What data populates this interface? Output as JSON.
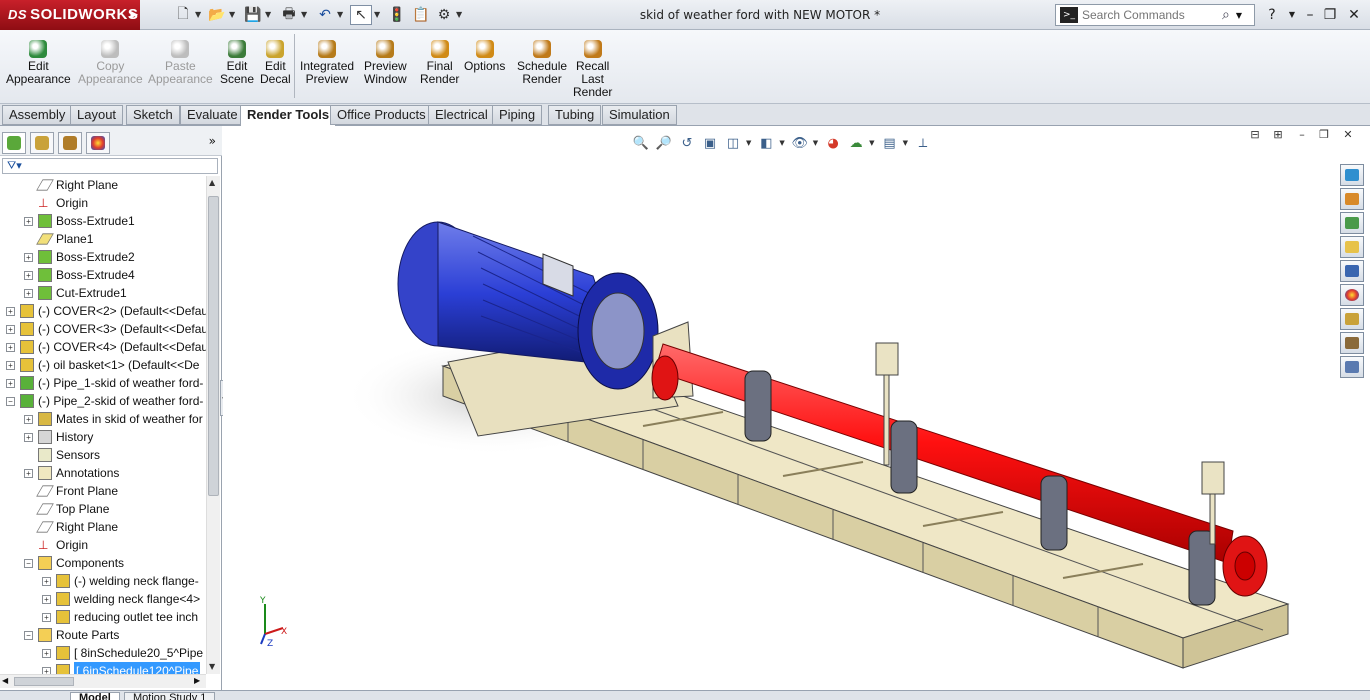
{
  "app": {
    "brand": "SOLIDWORKS",
    "brand_prefix": "DS",
    "doc_title": "skid of weather ford with NEW MOTOR *"
  },
  "search": {
    "placeholder": "Search Commands"
  },
  "command_manager": [
    {
      "label": "Edit Appearance",
      "lines": [
        "Edit",
        "Appearance"
      ],
      "enabled": true,
      "color": "#2e8b3d"
    },
    {
      "label": "Copy Appearance",
      "lines": [
        "Copy",
        "Appearance"
      ],
      "enabled": false,
      "color": "#bdbdbd"
    },
    {
      "label": "Paste Appearance",
      "lines": [
        "Paste",
        "Appearance"
      ],
      "enabled": false,
      "color": "#bdbdbd"
    },
    {
      "label": "Edit Scene",
      "lines": [
        "Edit",
        "Scene"
      ],
      "enabled": true,
      "color": "#3c7c3a"
    },
    {
      "label": "Edit Decal",
      "lines": [
        "Edit",
        "Decal"
      ],
      "enabled": true,
      "color": "#caa42e"
    },
    {
      "label": "Integrated Preview",
      "lines": [
        "Integrated",
        "Preview"
      ],
      "enabled": true,
      "color": "#b67b1a"
    },
    {
      "label": "Preview Window",
      "lines": [
        "Preview",
        "Window"
      ],
      "enabled": true,
      "color": "#b67b1a"
    },
    {
      "label": "Final Render",
      "lines": [
        "Final",
        "Render"
      ],
      "enabled": true,
      "color": "#d08a16"
    },
    {
      "label": "Options",
      "lines": [
        "Options"
      ],
      "enabled": true,
      "color": "#d08a16"
    },
    {
      "label": "Schedule Render",
      "lines": [
        "Schedule",
        "Render"
      ],
      "enabled": true,
      "color": "#c07a1a"
    },
    {
      "label": "Recall Last Render",
      "lines": [
        "Recall",
        "Last",
        "Render"
      ],
      "enabled": true,
      "color": "#c07a1a"
    }
  ],
  "tabs": [
    {
      "label": "Assembly",
      "active": false
    },
    {
      "label": "Layout",
      "active": false
    },
    {
      "label": "Sketch",
      "active": false
    },
    {
      "label": "Evaluate",
      "active": false
    },
    {
      "label": "Render Tools",
      "active": true
    },
    {
      "label": "Office Products",
      "active": false
    },
    {
      "label": "Electrical",
      "active": false
    },
    {
      "label": "Piping",
      "active": false
    },
    {
      "label": "Tubing",
      "active": false
    },
    {
      "label": "Simulation",
      "active": false
    }
  ],
  "tree": [
    {
      "label": "Right Plane",
      "level": 2,
      "icon": "plane",
      "expand": false
    },
    {
      "label": "Origin",
      "level": 2,
      "icon": "origin",
      "expand": false
    },
    {
      "label": "Boss-Extrude1",
      "level": 2,
      "icon": "feature",
      "expand": true
    },
    {
      "label": "Plane1",
      "level": 2,
      "icon": "plane-y",
      "expand": false
    },
    {
      "label": "Boss-Extrude2",
      "level": 2,
      "icon": "feature",
      "expand": true
    },
    {
      "label": "Boss-Extrude4",
      "level": 2,
      "icon": "feature",
      "expand": true
    },
    {
      "label": "Cut-Extrude1",
      "level": 2,
      "icon": "feature",
      "expand": true
    },
    {
      "label": "(-) COVER<2> (Default<<Defau",
      "level": 1,
      "icon": "part",
      "expand": true
    },
    {
      "label": "(-) COVER<3> (Default<<Defau",
      "level": 1,
      "icon": "part",
      "expand": true
    },
    {
      "label": "(-) COVER<4> (Default<<Defau",
      "level": 1,
      "icon": "part",
      "expand": true
    },
    {
      "label": "(-) oil basket<1> (Default<<De",
      "level": 1,
      "icon": "part",
      "expand": true
    },
    {
      "label": "(-) Pipe_1-skid of weather ford-",
      "level": 1,
      "icon": "assembly",
      "expand": true
    },
    {
      "label": "(-) Pipe_2-skid of weather ford-",
      "level": 1,
      "icon": "assembly",
      "expand": true,
      "open": true
    },
    {
      "label": "Mates in skid of weather for",
      "level": 2,
      "icon": "mates",
      "expand": true
    },
    {
      "label": "History",
      "level": 2,
      "icon": "history",
      "expand": true
    },
    {
      "label": "Sensors",
      "level": 2,
      "icon": "sensors",
      "expand": false
    },
    {
      "label": "Annotations",
      "level": 2,
      "icon": "annotations",
      "expand": true
    },
    {
      "label": "Front Plane",
      "level": 2,
      "icon": "plane",
      "expand": false
    },
    {
      "label": "Top Plane",
      "level": 2,
      "icon": "plane",
      "expand": false
    },
    {
      "label": "Right Plane",
      "level": 2,
      "icon": "plane",
      "expand": false
    },
    {
      "label": "Origin",
      "level": 2,
      "icon": "origin",
      "expand": false
    },
    {
      "label": "Components",
      "level": 2,
      "icon": "folder",
      "expand": true,
      "open": true
    },
    {
      "label": "(-) welding neck flange-",
      "level": 3,
      "icon": "part",
      "expand": true
    },
    {
      "label": "welding neck flange<4>",
      "level": 3,
      "icon": "part",
      "expand": true
    },
    {
      "label": "reducing outlet tee inch",
      "level": 3,
      "icon": "part",
      "expand": true
    },
    {
      "label": "Route Parts",
      "level": 2,
      "icon": "folder",
      "expand": true,
      "open": true
    },
    {
      "label": "[ 8inSchedule20_5^Pipe",
      "level": 3,
      "icon": "part",
      "expand": true
    },
    {
      "label": "[ 6inSchedule120^Pipe",
      "level": 3,
      "icon": "part",
      "expand": true,
      "selected": true
    }
  ],
  "bottom_tabs": [
    {
      "label": "Model",
      "active": true
    },
    {
      "label": "Motion Study 1",
      "active": false
    }
  ],
  "triad": {
    "x": "X",
    "y": "Y",
    "z": "Z"
  },
  "colors": {
    "pipe": "#ff1010",
    "motor": "#2b3fd6",
    "skid": "#e7dfbf",
    "accent": "#3399ff"
  }
}
